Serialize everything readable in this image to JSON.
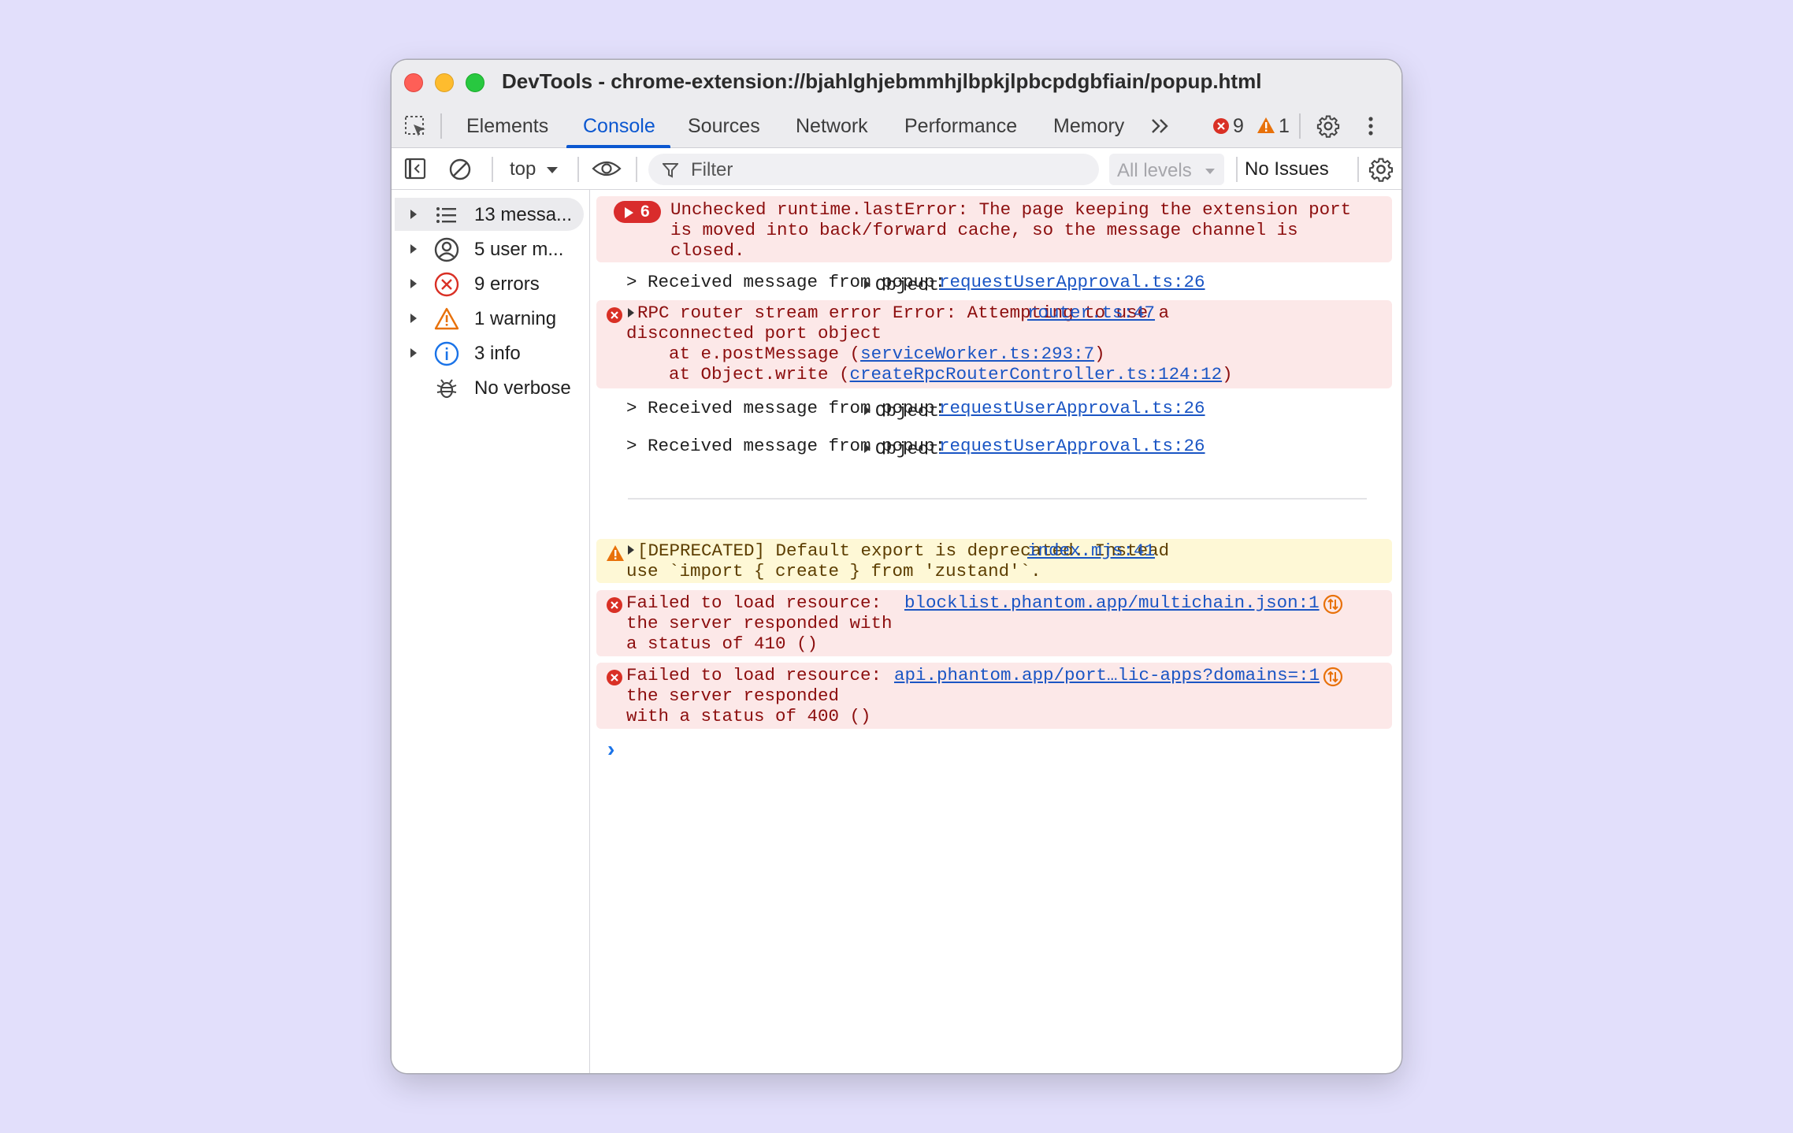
{
  "window": {
    "title": "DevTools - chrome-extension://bjahlghjebmmhjlbpkjlpbcpdgbfiain/popup.html"
  },
  "tabs": {
    "items": [
      "Elements",
      "Console",
      "Sources",
      "Network",
      "Performance",
      "Memory"
    ],
    "active": "Console",
    "more": "»",
    "error_count": "9",
    "warning_count": "1"
  },
  "toolbar": {
    "context": "top",
    "filter_placeholder": "Filter",
    "levels": "All levels",
    "issues": "No Issues"
  },
  "sidebar": {
    "items": [
      {
        "label": "13 messa...",
        "icon": "list-icon"
      },
      {
        "label": "5 user m...",
        "icon": "user-icon"
      },
      {
        "label": "9 errors",
        "icon": "error-icon"
      },
      {
        "label": "1 warning",
        "icon": "warning-icon"
      },
      {
        "label": "3 info",
        "icon": "info-icon"
      },
      {
        "label": "No verbose",
        "icon": "bug-icon"
      }
    ]
  },
  "console": {
    "msg1": {
      "count": "6",
      "lines": [
        "Unchecked runtime.lastError: The page keeping the extension port",
        "is moved into back/forward cache, so the message channel is",
        "closed."
      ]
    },
    "log1": {
      "text": "> Received message from popup:",
      "object": "Object",
      "source": "requestUserApproval.ts:26"
    },
    "msg2": {
      "line1": "RPC router stream error Error: Attempting to use a",
      "line2": "disconnected port object",
      "line3_prefix": "    at e.postMessage (",
      "line3_link": "serviceWorker.ts:293:7",
      "line3_suffix": ")",
      "line4_prefix": "    at Object.write (",
      "line4_link": "createRpcRouterController.ts:124:12",
      "line4_suffix": ")",
      "source": "router.ts:47"
    },
    "log2": {
      "text": "> Received message from popup:",
      "object": "Object",
      "source": "requestUserApproval.ts:26"
    },
    "log3": {
      "text": "> Received message from popup:",
      "object": "Object",
      "source": "requestUserApproval.ts:26"
    },
    "warn1": {
      "line1": "[DEPRECATED] Default export is deprecated. Instead",
      "line2": "use `import { create } from 'zustand'`.",
      "source": "index.mjs:41"
    },
    "err3": {
      "line1": "Failed to load resource:",
      "line2": "the server responded with",
      "line3": "a status of 410 ()",
      "link": "blocklist.phantom.app/multichain.json:1"
    },
    "err4": {
      "line1": "Failed to load resource:",
      "line2": "the server responded",
      "line3": "with a status of 400 ()",
      "link": "api.phantom.app/port…lic-apps?domains=:1"
    },
    "prompt": "›"
  }
}
